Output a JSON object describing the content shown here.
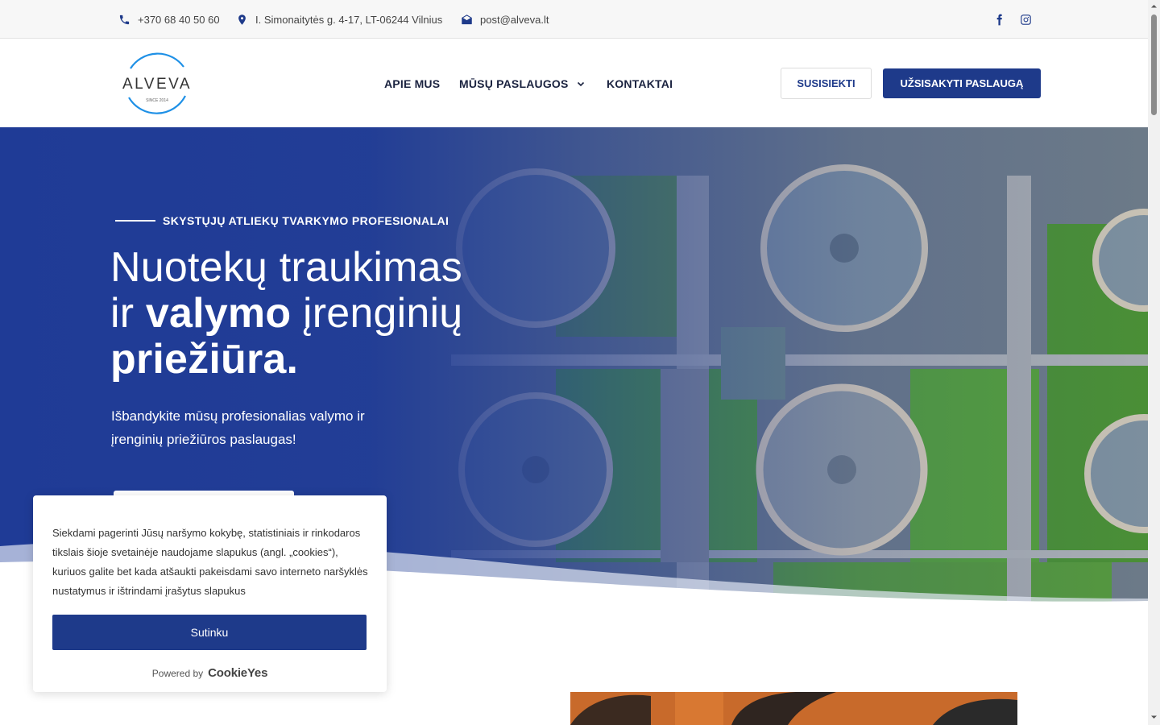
{
  "topbar": {
    "phone": "+370 68 40 50 60",
    "address": "I. Simonaitytės g. 4-17, LT-06244 Vilnius",
    "email": "post@alveva.lt"
  },
  "header": {
    "logo_text": "ALVEVA",
    "logo_since": "SINCE 2014",
    "nav": {
      "about": "APIE MUS",
      "services": "MŪSŲ PASLAUGOS",
      "contacts": "KONTAKTAI"
    },
    "contact_button": "SUSISIEKTI",
    "order_button": "UŽSISAKYTI PASLAUGĄ"
  },
  "hero": {
    "eyebrow": "SKYSTŲJŲ ATLIEKŲ TVARKYMO PROFESIONALAI",
    "title_line1": "Nuotekų traukimas",
    "title_line2_pre": "ir ",
    "title_line2_bold": "valymo",
    "title_line2_post": " įrenginių",
    "title_line3_bold": "priežiūra.",
    "subtitle": "Išbandykite mūsų profesionalias valymo ir įrenginių priežiūros paslaugas!"
  },
  "cookie": {
    "text": "Siekdami pagerinti Jūsų naršymo kokybę, statistiniais ir rinkodaros tikslais šioje svetainėje naudojame slapukus (angl. „cookies“), kuriuos galite bet kada atšaukti pakeisdami savo interneto naršyklės nustatymus ir ištrindami įrašytus slapukus",
    "accept_button": "Sutinku",
    "powered_by": "Powered by",
    "brand": "CookieYes"
  },
  "colors": {
    "brand_blue": "#1e3a8a",
    "hero_blue": "#1f3b96",
    "grass": "#4f9a3a"
  },
  "icons": [
    "phone-icon",
    "location-icon",
    "email-icon",
    "facebook-icon",
    "instagram-icon",
    "chevron-down-icon"
  ]
}
